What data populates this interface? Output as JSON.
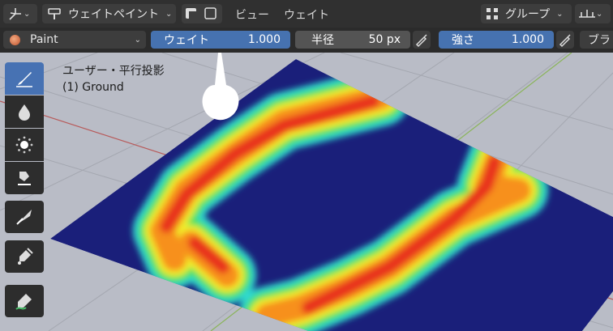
{
  "header": {
    "mode_label": "ウェイトペイント",
    "menus": [
      "ビュー",
      "ウェイト"
    ],
    "group_label": "グループ"
  },
  "toolbar": {
    "brush_name": "Paint",
    "weight": {
      "label": "ウェイト",
      "value": "1.000"
    },
    "radius": {
      "label": "半径",
      "value": "50 px"
    },
    "strength": {
      "label": "強さ",
      "value": "1.000"
    },
    "blur_label": "ブラ"
  },
  "viewport": {
    "projection_label": "ユーザー・平行投影",
    "object_label": "(1) Ground"
  },
  "tools": [
    "draw-tool",
    "blur-tool",
    "average-tool",
    "smear-tool",
    "gradient-tool",
    "sample-weight-tool",
    "annotate-tool"
  ],
  "colors": {
    "weight_field": "#4672b0",
    "plane_base": "#1a1f7a",
    "active_tool": "#4772b3"
  }
}
